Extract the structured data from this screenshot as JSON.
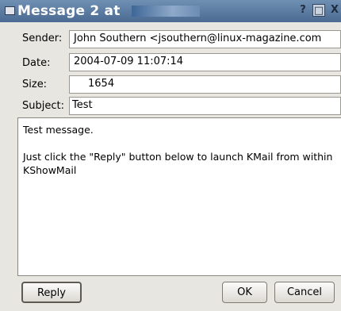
{
  "window": {
    "title": "Message 2 at",
    "help_button": "?",
    "maximize_button": "□",
    "close_button": "X"
  },
  "fields": {
    "sender_label": "Sender:",
    "sender_value": "John Southern <jsouthern@linux-magazine.com",
    "date_label": "Date:",
    "date_value": "2004-07-09 11:07:14",
    "size_label": "Size:",
    "size_value": "1654",
    "subject_label": "Subject:",
    "subject_value": "Test"
  },
  "message": {
    "line1": "Test message.",
    "line2": "Just click the \"Reply\" button below to launch KMail from within KShowMail"
  },
  "buttons": {
    "reply": "Reply",
    "ok": "OK",
    "cancel": "Cancel"
  }
}
